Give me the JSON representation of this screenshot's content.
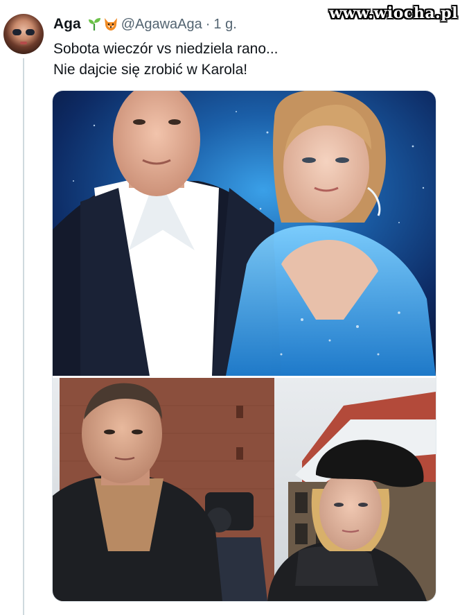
{
  "tweet": {
    "author_name": "Aga",
    "author_handle": "@AgawaAga",
    "separator": "·",
    "time": "1 g.",
    "text_line_1": "Sobota wieczór vs niedziela rano...",
    "text_line_2": "Nie dajcie się zrobić w Karola!"
  },
  "watermark": "www.wiocha.pl",
  "emoji_icons": [
    "seedling-icon",
    "fox-icon"
  ],
  "colors": {
    "muted_text": "#536471",
    "thread_line": "#cfd9de",
    "cosmic_blue": "#1b5fa8"
  }
}
